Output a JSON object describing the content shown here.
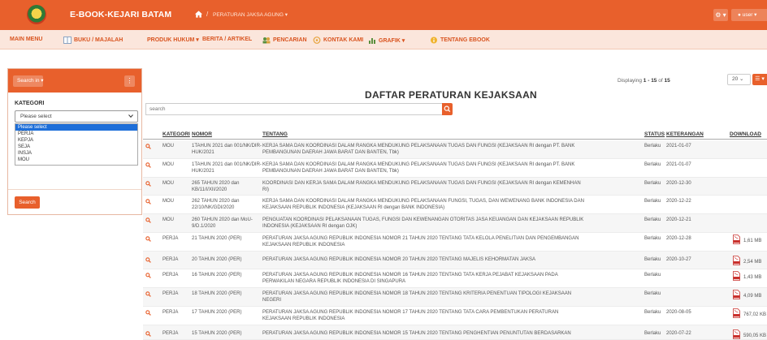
{
  "header": {
    "brand": "E-BOOK-KEJARI BATAM",
    "crumb_sep": "/",
    "crumb": "PERATURAN JAKSA AGUNG ▾",
    "gear_label": "⚙ ▾",
    "user_label": "user ▾",
    "colors": {
      "brand_orange": "#e8602c",
      "menu_bg": "#fbe6dc",
      "link": "#d9541f"
    }
  },
  "menu": {
    "items": [
      {
        "label": "MAIN MENU",
        "icon": ""
      },
      {
        "label": "BUKU / MAJALAH",
        "icon": "book-icon"
      },
      {
        "label": "PRODUK HUKUM ▾",
        "icon": ""
      },
      {
        "label": "BERITA / ARTIKEL",
        "icon": ""
      },
      {
        "label": "PENCARIAN",
        "icon": "users-icon"
      },
      {
        "label": "KONTAK KAMI",
        "icon": "contact-icon"
      },
      {
        "label": "GRAFIK ▾",
        "icon": "bar-chart-icon"
      },
      {
        "label": "TENTANG EBOOK",
        "icon": "info-icon"
      }
    ]
  },
  "sidebar": {
    "search_in_label": "Search in ▾",
    "menu_label": "⋮",
    "kategori_label": "KATEGORI",
    "select_value": "Please select",
    "options": [
      "Please select",
      "PERJA",
      "KEPJA",
      "SEJA",
      "INSJA",
      "MOU"
    ],
    "search_button": "Search"
  },
  "content": {
    "displaying_prefix": "Displaying ",
    "displaying_range": "1 - 15",
    "displaying_of": " of ",
    "displaying_total": "15",
    "page_size": "20 ⌄",
    "list_btn": "☰ ▾",
    "title": "DAFTAR PERATURAN KEJAKSAAN",
    "search_placeholder": "search"
  },
  "table": {
    "headers": {
      "kategori": "KATEGORI",
      "nomor": "NOMOR",
      "tentang": "TENTANG",
      "status": "STATUS",
      "keterangan": "KETERANGAN",
      "download": "DOWNLOAD"
    },
    "rows": [
      {
        "kategori": "MOU",
        "nomor": [
          "1TAHUN 2021 dan 001/NK/DIR-",
          "HUK/2021"
        ],
        "tentang": [
          "KERJA SAMA DAN KOORDINASI DALAM RANGKA MENDUKUNG PELAKSANAAN TUGAS DAN FUNGSI (KEJAKSAAN RI dengan PT. BANK",
          "PEMBANGUNAN DAERAH JAWA BARAT DAN BANTEN, Tbk)"
        ],
        "status": "Berlaku",
        "keterangan": "2021-01-07",
        "download": ""
      },
      {
        "kategori": "MOU",
        "nomor": [
          "1TAHUN 2021 dan 001/NK/DIR-",
          "HUK/2021"
        ],
        "tentang": [
          "KERJA SAMA DAN KOORDINASI DALAM RANGKA MENDUKUNG PELAKSANAAN TUGAS DAN FUNGSI (KEJAKSAAN RI dengan PT. BANK",
          "PEMBANGUNAN DAERAH JAWA BARAT DAN BANTEN, Tbk)"
        ],
        "status": "Berlaku",
        "keterangan": "2021-01-07",
        "download": ""
      },
      {
        "kategori": "MOU",
        "nomor": [
          "265 TAHUN 2020 dan",
          "KB/11/I/XII/2020"
        ],
        "tentang": [
          "KOORDINASI DAN KERJA SAMA DALAM RANGKA MENDUKUNG PELAKSANAAN TUGAS DAN FUNGSI (KEJAKSAAN RI dengan KEMENHAN",
          "RI)"
        ],
        "status": "Berlaku",
        "keterangan": "2020-12-30",
        "download": ""
      },
      {
        "kategori": "MOU",
        "nomor": [
          "262 TAHUN 2020 dan",
          "22/10/NK/GDI/2020"
        ],
        "tentang": [
          "KERJA SAMA DAN KOORDINASI DALAM RANGKA MENDUKUNG PELAKSANAAN FUNGSI, TUGAS, DAN WEWENANG BANK INDONESIA DAN",
          "KEJAKSAAN REPUBLIK INDONESIA (KEJAKSAAN RI dengan BANK INDONESIA)"
        ],
        "status": "Berlaku",
        "keterangan": "2020-12-22",
        "download": ""
      },
      {
        "kategori": "MOU",
        "nomor": [
          "260 TAHUN 2020 dan MoU-",
          "9/D.1/2020"
        ],
        "tentang": [
          "PENGUATAN KOORDINASI PELAKSANAAN TUGAS, FUNGSI DAN KEWENANGAN OTORITAS JASA KEUANGAN DAN KEJAKSAAN REPUBLIK",
          "INDONESIA (KEJAKSAAN RI dengan OJK)"
        ],
        "status": "Berlaku",
        "keterangan": "2020-12-21",
        "download": ""
      },
      {
        "kategori": "PERJA",
        "nomor": [
          "21 TAHUN 2020 (PER)"
        ],
        "tentang": [
          "PERATURAN JAKSA AGUNG REPUBLIK INDONESIA NOMOR 21 TAHUN 2020 TENTANG TATA KELOLA PENELITIAN DAN PENGEMBANGAN",
          "KEJAKSAAN REPUBLIK INDONESIA"
        ],
        "status": "Berlaku",
        "keterangan": "2020-12-28",
        "download": "1,61 MB"
      },
      {
        "kategori": "PERJA",
        "nomor": [
          "20 TAHUN 2020 (PER)"
        ],
        "tentang": [
          "PERATURAN JAKSA AGUNG REPUBLIK INDONESIA NOMOR 20 TAHUN 2020 TENTANG MAJELIS KEHORMATAN JAKSA"
        ],
        "status": "Berlaku",
        "keterangan": "2020-10-27",
        "download": "2,54 MB"
      },
      {
        "kategori": "PERJA",
        "nomor": [
          "16 TAHUN 2020 (PER)"
        ],
        "tentang": [
          "PERATURAN JAKSA AGUNG REPUBLIK INDONESIA NOMOR 16 TAHUN 2020 TENTANG TATA KERJA PEJABAT KEJAKSAAN PADA",
          "PERWAKILAN NEGARA REPUBLIK INDONESIA DI SINGAPURA"
        ],
        "status": "Berlaku",
        "keterangan": "",
        "download": "1,43 MB"
      },
      {
        "kategori": "PERJA",
        "nomor": [
          "18 TAHUN 2020 (PER)"
        ],
        "tentang": [
          "PERATURAN JAKSA AGUNG REPUBLIK INDONESIA NOMOR 18 TAHUN 2020 TENTANG KRITERIA PENENTUAN TIPOLOGI KEJAKSAAN",
          "NEGERI"
        ],
        "status": "Berlaku",
        "keterangan": "",
        "download": "4,09 MB"
      },
      {
        "kategori": "PERJA",
        "nomor": [
          "17 TAHUN 2020 (PER)"
        ],
        "tentang": [
          "PERATURAN JAKSA AGUNG REPUBLIK INDONESIA NOMOR 17 TAHUN 2020 TENTANG TATA CARA PEMBENTUKAN PERATURAN",
          "KEJAKSAAN REPUBLIK INDONESIA"
        ],
        "status": "Berlaku",
        "keterangan": "2020-08-05",
        "download": "767,02 KB"
      },
      {
        "kategori": "PERJA",
        "nomor": [
          "15 TAHUN 2020 (PER)"
        ],
        "tentang": [
          "PERATURAN JAKSA AGUNG REPUBLIK INDONESIA NOMOR 15 TAHUN 2020 TENTANG PENGHENTIAN PENUNTUTAN BERDASARKAN"
        ],
        "status": "Berlaku",
        "keterangan": "2020-07-22",
        "download": "590,05 KB"
      }
    ]
  }
}
